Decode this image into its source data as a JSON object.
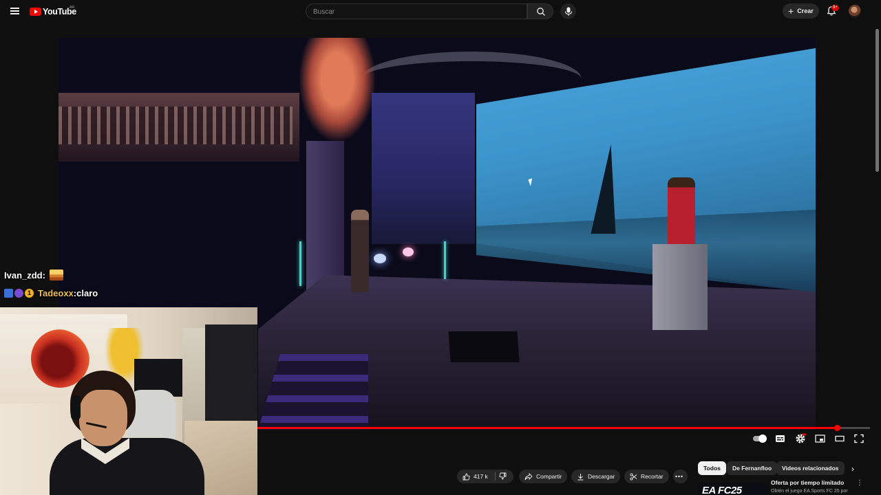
{
  "header": {
    "logo_text": "YouTube",
    "country_code": "AR",
    "search_placeholder": "Buscar",
    "create_label": "Crear",
    "notification_count": "9+"
  },
  "player": {
    "progress_fraction": 0.946
  },
  "actions": {
    "like_count": "417 k",
    "share_label": "Compartir",
    "download_label": "Descargar",
    "clip_label": "Recortar"
  },
  "chips": [
    {
      "label": "Todos",
      "active": true
    },
    {
      "label": "De Fernanfloo",
      "active": false
    },
    {
      "label": "Videos relacionados",
      "active": false
    }
  ],
  "ad": {
    "title": "Oferta por tiempo limitado",
    "description": "Obtén el juego EA Sports FC 25 por",
    "thumbnail_text": "EA FC25"
  },
  "chat": [
    {
      "user": "Ivan_zdd",
      "separator": " :",
      "message": ""
    },
    {
      "user": "Tadeoxx",
      "separator": " :",
      "message": " claro"
    }
  ],
  "colors": {
    "background": "#0f0f0f",
    "accent": "#ff0000",
    "pill": "#272727"
  }
}
